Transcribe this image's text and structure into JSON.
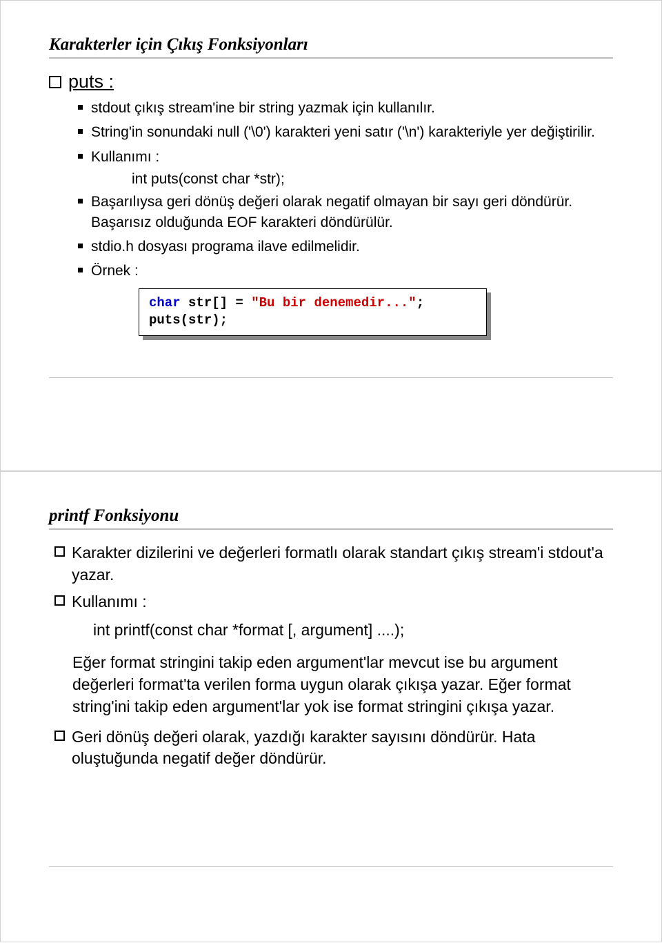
{
  "slide1": {
    "title": "Karakterler için Çıkış Fonksiyonları",
    "heading": "puts :",
    "bullets": {
      "b1": "stdout çıkış stream'ine bir string yazmak için kullanılır.",
      "b2": "String'in sonundaki null ('\\0') karakteri yeni satır ('\\n') karakteriyle yer değiştirilir.",
      "b3": "Kullanımı :",
      "b3_sig": "int puts(const char *str);",
      "b4": "Başarılıysa geri dönüş değeri olarak negatif olmayan bir sayı geri döndürür. Başarısız olduğunda EOF karakteri döndürülür.",
      "b5": "stdio.h dosyası programa ilave edilmelidir.",
      "b6": "Örnek :"
    },
    "code": {
      "kw": "char",
      "decl": " str[] = ",
      "str": "\"Bu bir denemedir...\"",
      "semi": ";",
      "line2": "puts(str);"
    }
  },
  "slide2": {
    "title": "printf Fonksiyonu",
    "bullets": {
      "b1": "Karakter dizilerini ve değerleri formatlı olarak standart çıkış stream'i stdout'a yazar.",
      "b2": "Kullanımı :",
      "b2_sig": "int printf(const char *format [, argument] ....);",
      "p1": "Eğer format stringini takip eden argument'lar mevcut ise bu argument değerleri format'ta verilen forma uygun olarak çıkışa yazar. Eğer format string'ini takip eden argument'lar yok ise format stringini çıkışa yazar.",
      "b3": "Geri dönüş değeri olarak, yazdığı karakter sayısını döndürür. Hata oluştuğunda negatif değer döndürür."
    }
  }
}
